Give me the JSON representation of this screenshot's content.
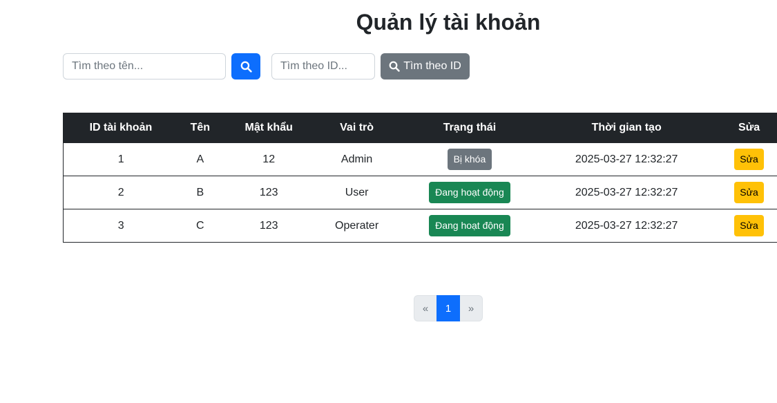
{
  "page": {
    "title": "Quản lý tài khoản"
  },
  "search": {
    "name_placeholder": "Tìm theo tên...",
    "name_value": "",
    "search_icon": "search-icon",
    "id_placeholder": "Tìm theo ID...",
    "id_value": "",
    "id_button_label": "Tìm theo ID"
  },
  "table": {
    "headers": [
      "ID tài khoản",
      "Tên",
      "Mật khẩu",
      "Vai trò",
      "Trạng thái",
      "Thời gian tạo",
      "Sửa"
    ],
    "rows": [
      {
        "id": "1",
        "name": "A",
        "password": "12",
        "role": "Admin",
        "status": "Bị khóa",
        "status_kind": "locked",
        "created": "2025-03-27 12:32:27",
        "edit": "Sửa"
      },
      {
        "id": "2",
        "name": "B",
        "password": "123",
        "role": "User",
        "status": "Đang hoạt động",
        "status_kind": "active",
        "created": "2025-03-27 12:32:27",
        "edit": "Sửa"
      },
      {
        "id": "3",
        "name": "C",
        "password": "123",
        "role": "Operater",
        "status": "Đang hoạt động",
        "status_kind": "active",
        "created": "2025-03-27 12:32:27",
        "edit": "Sửa"
      }
    ]
  },
  "pagination": {
    "prev": "«",
    "current": "1",
    "next": "»"
  },
  "colors": {
    "primary": "#0d6efd",
    "secondary": "#6c757d",
    "dark": "#212529",
    "success": "#198754",
    "warning": "#ffc107"
  }
}
